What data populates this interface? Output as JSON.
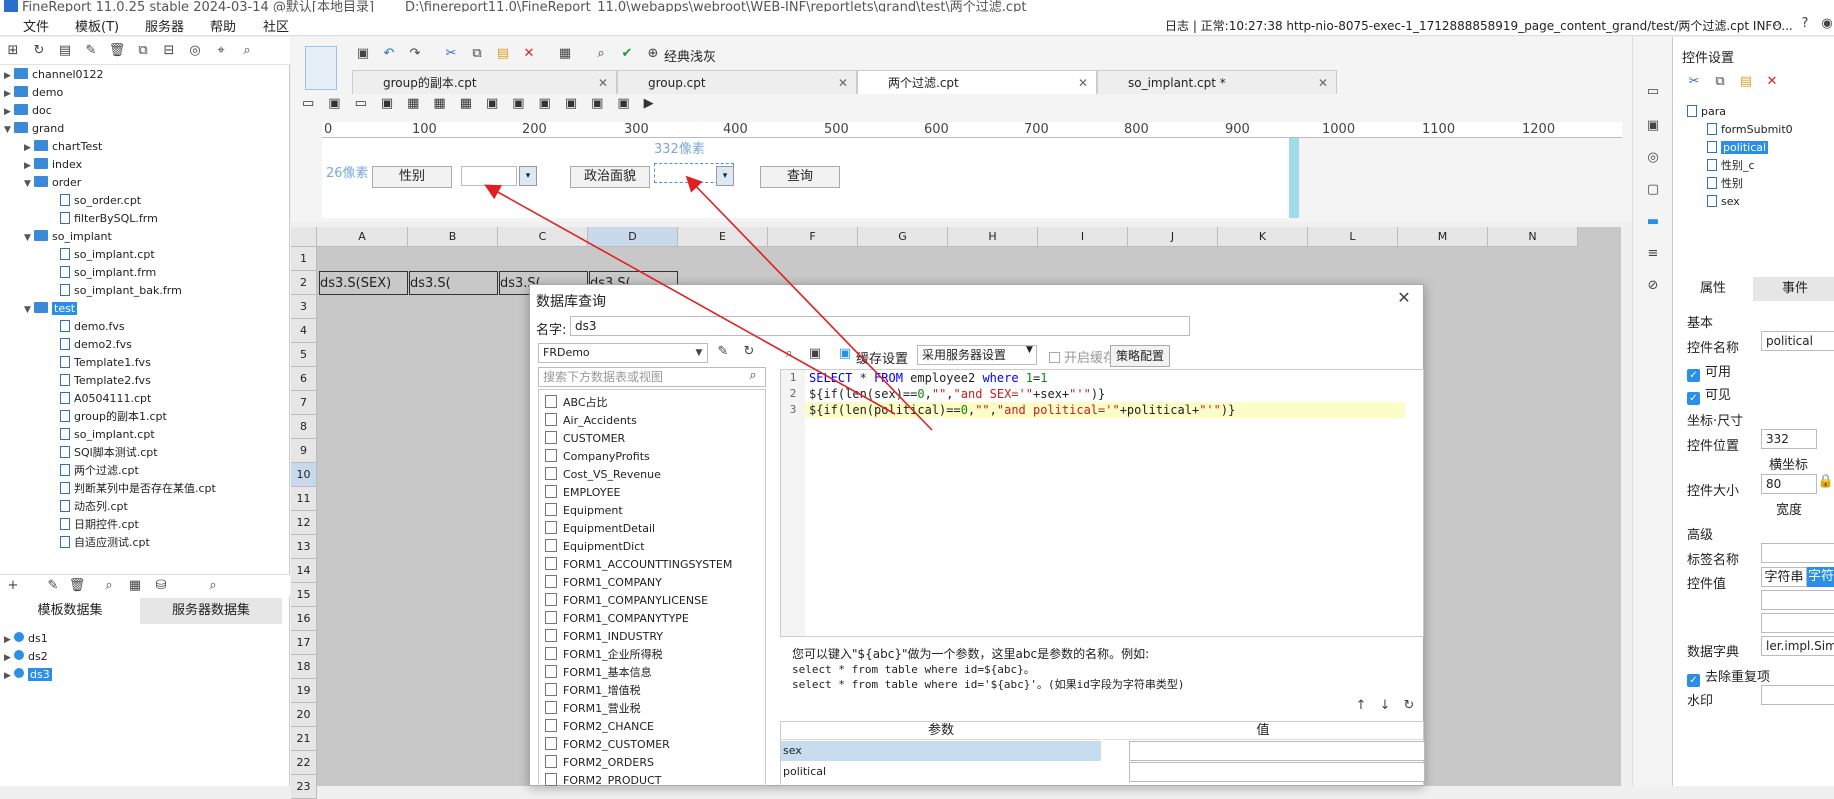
{
  "titlebar": {
    "left": "FineReport 11.0.25 stable 2024-03-14 @默认[本地目录]",
    "path": "D:\\finereport11.0\\FineReport_11.0\\webapps\\webroot\\WEB-INF\\reportlets\\grand\\test\\两个过滤.cpt"
  },
  "menu": {
    "file": "文件",
    "template": "模板(T)",
    "server": "服务器",
    "help": "帮助",
    "community": "社区"
  },
  "log": {
    "text": "日志 | 正常:10:27:38 http-nio-8075-exec-1_1712888858919_page_content_grand/test/两个过滤.cpt INFO..."
  },
  "tree": {
    "items": [
      "channel0122",
      "demo",
      "doc",
      "grand",
      "chartTest",
      "index",
      "order",
      "so_order.cpt",
      "filterBySQL.frm",
      "so_implant",
      "so_implant.cpt",
      "so_implant.frm",
      "so_implant_bak.frm",
      "test",
      "demo.fvs",
      "demo2.fvs",
      "Template1.fvs",
      "Template2.fvs",
      "A0504111.cpt",
      "group的副本1.cpt",
      "so_implant.cpt",
      "SQl脚本测试.cpt",
      "两个过滤.cpt",
      "判断某列中是否存在某值.cpt",
      "动态列.cpt",
      "日期控件.cpt",
      "自适应测试.cpt"
    ]
  },
  "datasets": {
    "tab_template": "模板数据集",
    "tab_server": "服务器数据集",
    "items": [
      "ds1",
      "ds2",
      "ds3"
    ]
  },
  "toolbar": {
    "theme": "经典浅灰"
  },
  "tabs": [
    "group的副本.cpt",
    "group.cpt",
    "两个过滤.cpt",
    "so_implant.cpt *"
  ],
  "ruler": [
    "0",
    "100",
    "200",
    "300",
    "400",
    "500",
    "600",
    "700",
    "800",
    "900",
    "1000",
    "1100",
    "1200",
    "1300"
  ],
  "param_canvas": {
    "px26": "26像素",
    "px332": "332像素",
    "sex_label": "性别",
    "political_label": "政治面貌",
    "query_btn": "查询"
  },
  "grid": {
    "cols": [
      "A",
      "B",
      "C",
      "D",
      "E",
      "F",
      "G",
      "H",
      "I",
      "J",
      "K",
      "L",
      "M",
      "N"
    ],
    "rows": [
      "1",
      "2",
      "3",
      "4",
      "5",
      "6",
      "7",
      "8",
      "9",
      "10",
      "11",
      "12",
      "13",
      "14",
      "15",
      "16",
      "17",
      "18",
      "19",
      "20",
      "21",
      "22",
      "23"
    ],
    "cells": [
      "ds3.S(SEX)",
      "ds3.S(",
      "ds3.S(",
      "ds3.S("
    ]
  },
  "dialog": {
    "title": "数据库查询",
    "name_label": "名字:",
    "name_value": "ds3",
    "connection": "FRDemo",
    "search_placeholder": "搜索下方数据表或视图",
    "cache_label": "缓存设置",
    "server_setting": "采用服务器设置",
    "enable_cache": "开启缓存",
    "strategy": "策略配置",
    "tables": [
      "ABC占比",
      "Air_Accidents",
      "CUSTOMER",
      "CompanyProfits",
      "Cost_VS_Revenue",
      "EMPLOYEE",
      "Equipment",
      "EquipmentDetail",
      "EquipmentDict",
      "FORM1_ACCOUNTTINGSYSTEM",
      "FORM1_COMPANY",
      "FORM1_COMPANYLICENSE",
      "FORM1_COMPANYTYPE",
      "FORM1_INDUSTRY",
      "FORM1_企业所得税",
      "FORM1_基本信息",
      "FORM1_增值税",
      "FORM1_营业税",
      "FORM2_CHANCE",
      "FORM2_CUSTOMER",
      "FORM2_ORDERS",
      "FORM2_PRODUCT"
    ],
    "sql_lines": [
      "SELECT * FROM employee2 where 1=1",
      "${if(len(sex)==0,\"\",\"and SEX='\"+sex+\"'\")}",
      "${if(len(political)==0,\"\",\"and political='\"+political+\"'\")}"
    ],
    "hint1": "您可以键入\"${abc}\"做为一个参数，这里abc是参数的名称。例如:",
    "hint2": "select * from table where id=${abc}。",
    "hint3": "select * from table where id='${abc}'。(如果id字段为字符串类型)",
    "param_header": "参数",
    "value_header": "值",
    "params": [
      "sex",
      "political"
    ]
  },
  "right": {
    "header": "控件设置",
    "tree": [
      "para",
      "formSubmit0",
      "political",
      "性别_c",
      "性别",
      "sex"
    ],
    "tab_attr": "属性",
    "tab_event": "事件",
    "basic": "基本",
    "widget_name_label": "控件名称",
    "widget_name": "political",
    "enabled": "可用",
    "visible": "可见",
    "pos_size": "坐标·尺寸",
    "pos_label": "控件位置",
    "pos_value": "332",
    "x_label": "横坐标",
    "size_label": "控件大小",
    "size_value": "80",
    "width_label": "宽度",
    "advanced": "高级",
    "tag_label": "标签名称",
    "value_label": "控件值",
    "string": "字符串",
    "string_tab": "字符",
    "dict_label": "数据字典",
    "dict_value": "ler.impl.SimG",
    "dedupe": "去除重复项",
    "watermark": "水印"
  }
}
